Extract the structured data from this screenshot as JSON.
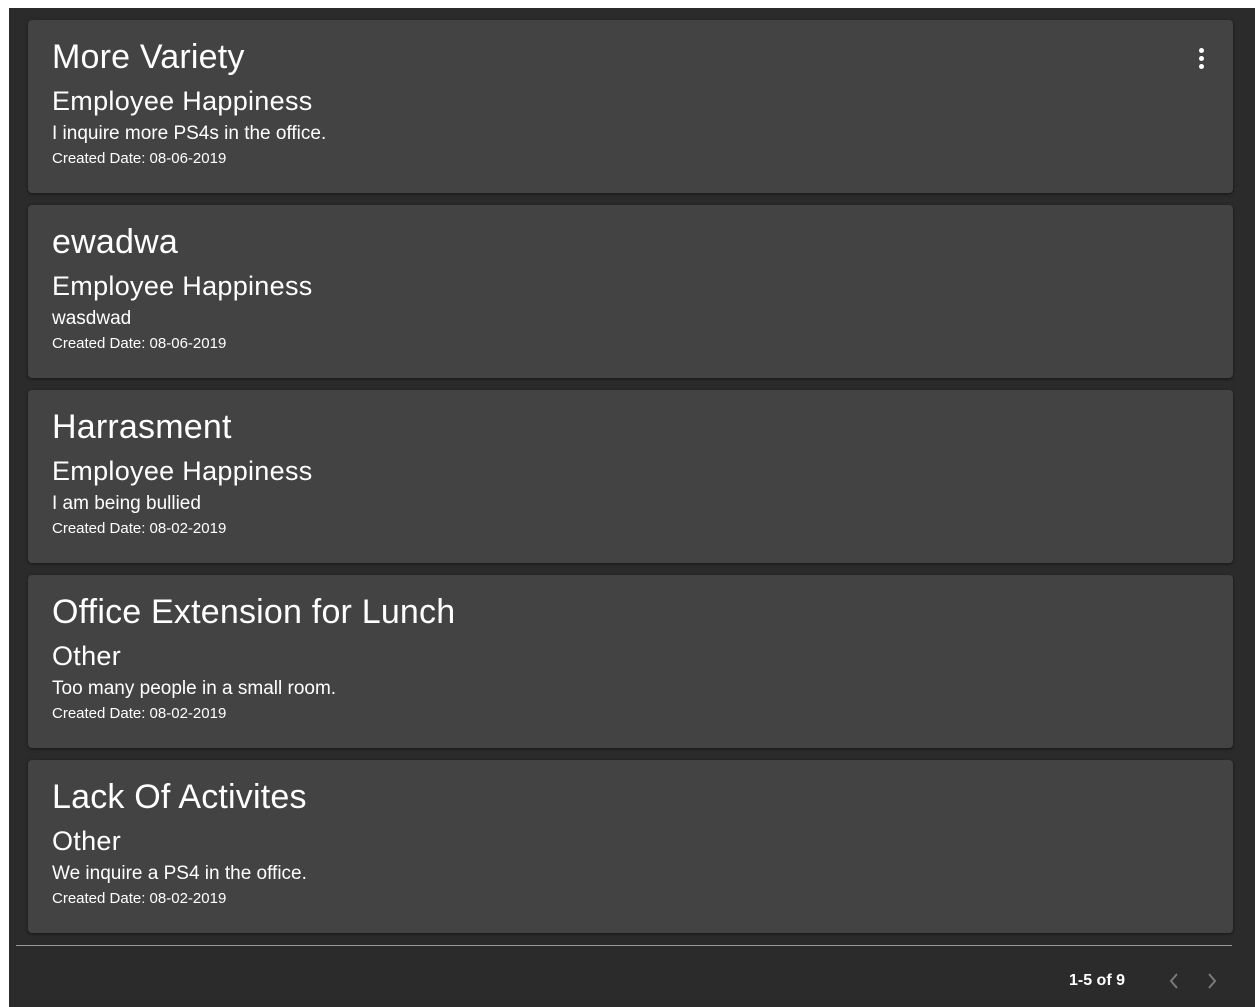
{
  "cards": [
    {
      "title": "More Variety",
      "category": "Employee Happiness",
      "description": "I inquire more PS4s in the office.",
      "date": "Created Date: 08-06-2019"
    },
    {
      "title": "ewadwa",
      "category": "Employee Happiness",
      "description": "wasdwad",
      "date": "Created Date: 08-06-2019"
    },
    {
      "title": "Harrasment",
      "category": "Employee Happiness",
      "description": "I am being bullied",
      "date": "Created Date: 08-02-2019"
    },
    {
      "title": "Office Extension for Lunch",
      "category": "Other",
      "description": "Too many people in a small room.",
      "date": "Created Date: 08-02-2019"
    },
    {
      "title": "Lack Of Activites",
      "category": "Other",
      "description": "We inquire a PS4 in the office.",
      "date": "Created Date: 08-02-2019"
    }
  ],
  "pagination": {
    "range": "1-5 of 9"
  },
  "icons": {
    "more": "more-vert-icon",
    "prev": "chevron-left-icon",
    "next": "chevron-right-icon"
  },
  "colors": {
    "background": "#2b2b2b",
    "card": "#434343",
    "text": "#ffffff",
    "disabled": "#7a7a7a"
  }
}
